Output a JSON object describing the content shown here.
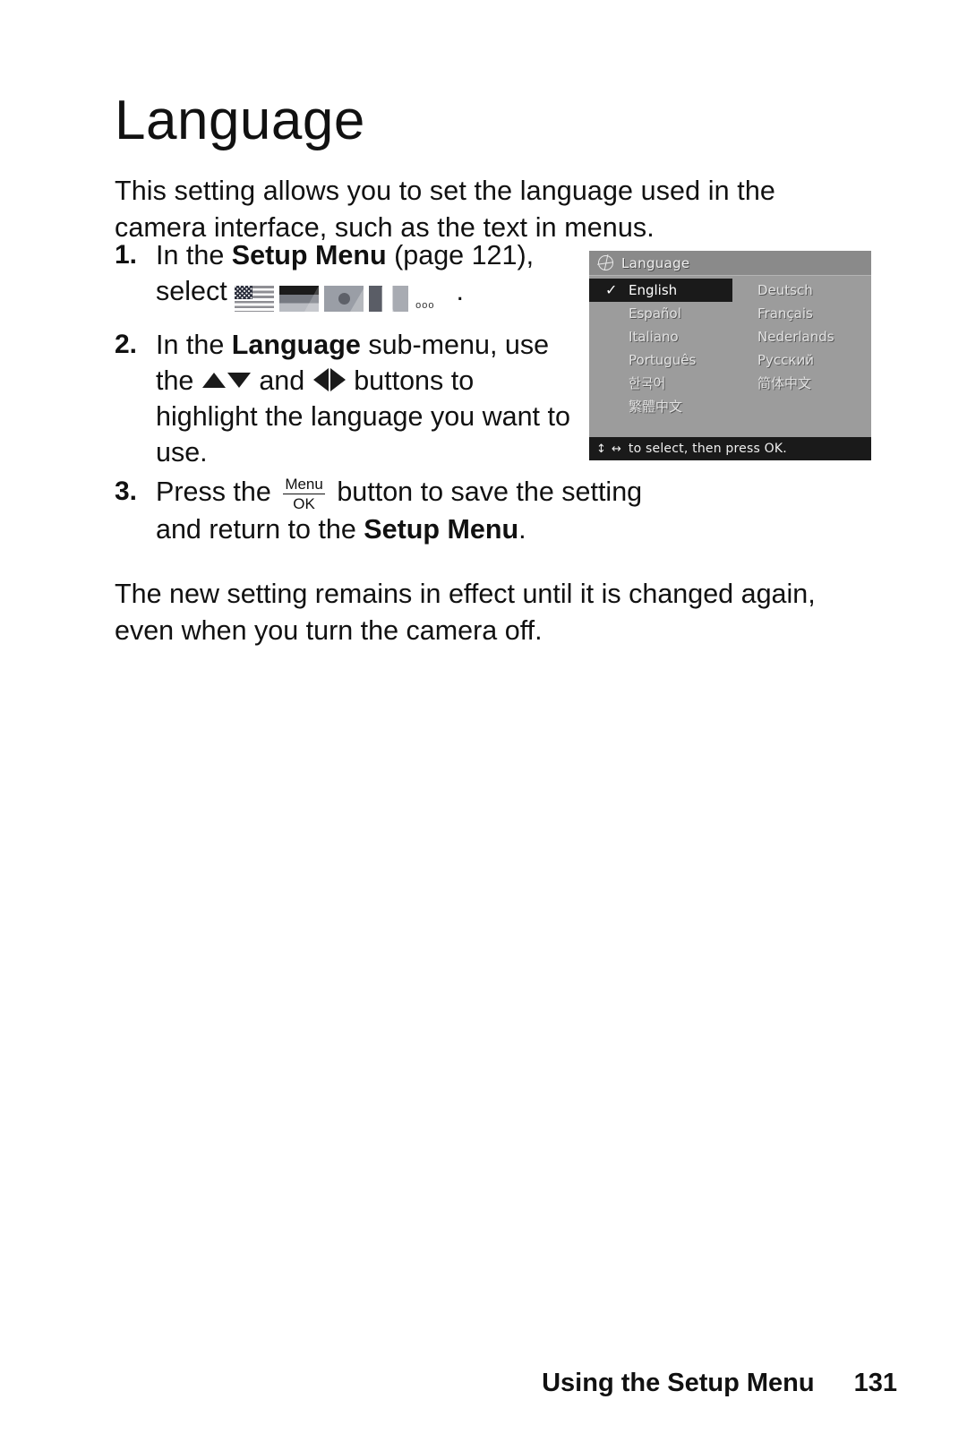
{
  "document": {
    "title": "Language",
    "intro": "This setting allows you to set the language used in the camera interface, such as the text in menus.",
    "closing": "The new setting remains in effect until it is changed again, even when you turn the camera off."
  },
  "steps": [
    {
      "number": "1.",
      "text_before": "In the ",
      "bold1": "Setup Menu",
      "text_mid": " (page 121), select ",
      "icons": [
        "us-flag-icon",
        "german-flag-icon",
        "japanese-flag-icon",
        "tricolor-flag-icon"
      ],
      "icon_tail": "ooo",
      "text_after": "."
    },
    {
      "number": "2.",
      "text_before": "In the ",
      "bold1": "Language",
      "text_mid": " sub-menu, use the ",
      "icons": [
        "arrow-up-icon",
        "arrow-down-icon",
        "arrow-left-icon",
        "arrow-right-icon"
      ],
      "conjunction": " and ",
      "text_after": " buttons to highlight the language you want to use."
    },
    {
      "number": "3.",
      "text_before": "Press the ",
      "button_top": "Menu",
      "button_bottom": "OK",
      "text_mid": " button to save the setting and return to the ",
      "bold1": "Setup Menu",
      "text_after": "."
    }
  ],
  "lcd": {
    "header_icon": "globe-icon",
    "title": "Language",
    "columns": {
      "left": [
        {
          "label": "English",
          "selected": true,
          "check": "✓"
        },
        {
          "label": "Español",
          "selected": false
        },
        {
          "label": "Italiano",
          "selected": false
        },
        {
          "label": "Português",
          "selected": false
        },
        {
          "label": "한국어",
          "selected": false
        },
        {
          "label": "繁體中文",
          "selected": false
        }
      ],
      "right": [
        {
          "label": "Deutsch",
          "selected": false
        },
        {
          "label": "Français",
          "selected": false
        },
        {
          "label": "Nederlands",
          "selected": false
        },
        {
          "label": "Русский",
          "selected": false
        },
        {
          "label": "简体中文",
          "selected": false
        }
      ]
    },
    "footer": {
      "arrows": "↕ ↔",
      "text": "to select, then press OK."
    }
  },
  "footer": {
    "label": "Using the Setup Menu",
    "page_number": "131"
  },
  "colors": {
    "text": "#111111",
    "lcd_background": "#9c9c9c",
    "lcd_header": "#8a8a8a",
    "lcd_selected": "#1a1a1a",
    "lcd_text": "#e2e2e2"
  }
}
